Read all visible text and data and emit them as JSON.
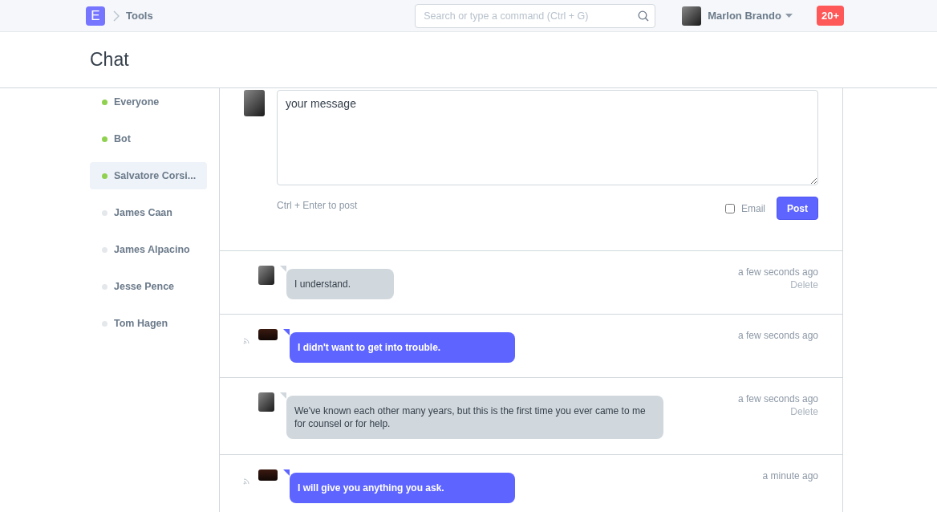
{
  "navbar": {
    "logo": "E",
    "breadcrumb": "Tools",
    "search": {
      "placeholder": "Search or type a command (Ctrl + G)"
    },
    "user": "Marlon Brando",
    "notifications": "20+"
  },
  "page_title": "Chat",
  "contacts": [
    {
      "name": "Everyone",
      "online": true,
      "selected": false
    },
    {
      "name": "Bot",
      "online": true,
      "selected": false
    },
    {
      "name": "Salvatore Corsi...",
      "online": true,
      "selected": true
    },
    {
      "name": "James Caan",
      "online": false,
      "selected": false
    },
    {
      "name": "James Alpacino",
      "online": false,
      "selected": false
    },
    {
      "name": "Jesse Pence",
      "online": false,
      "selected": false
    },
    {
      "name": "Tom Hagen",
      "online": false,
      "selected": false
    }
  ],
  "composer": {
    "value": "your message",
    "hint": "Ctrl + Enter to post",
    "email_label": "Email",
    "email_checked": false,
    "post_button": "Post"
  },
  "messages": [
    {
      "kind": "sent",
      "text": "I understand.",
      "time": "a few seconds ago",
      "delete": "Delete"
    },
    {
      "kind": "received",
      "text": "I didn't want to get into trouble.",
      "time": "a few seconds ago"
    },
    {
      "kind": "sent",
      "text": "We've known each other many years, but this is the first time you ever came to me for counsel or for help.",
      "time": "a few seconds ago",
      "delete": "Delete"
    },
    {
      "kind": "received",
      "text": "I will give you anything you ask.",
      "time": "a minute ago"
    }
  ]
}
